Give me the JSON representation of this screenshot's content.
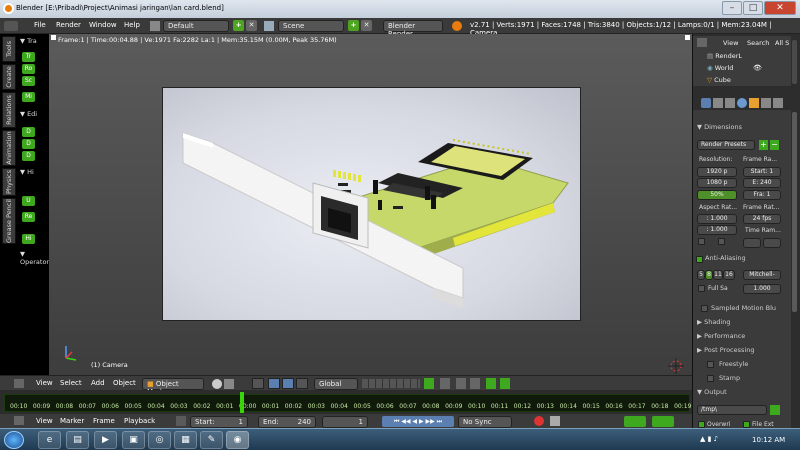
{
  "window": {
    "title": "Blender [E:\\Pribadi\\Project\\Animasi jaringan\\lan card.blend]"
  },
  "topbar": {
    "menus": [
      "File",
      "Render",
      "Window",
      "Help"
    ],
    "layout": "Default",
    "scene": "Scene",
    "engine": "Blender Render",
    "stats": "v2.71 | Verts:1971 | Faces:1748 | Tris:3840 | Objects:1/12 | Lamps:0/1 | Mem:23.04M | Camera"
  },
  "tool_tabs": [
    "Tools",
    "Create",
    "Relations",
    "Animation",
    "Physics",
    "Grease Pencil"
  ],
  "tool_panel": {
    "sections": [
      "Tra",
      "Edi",
      "Hi",
      "Operator"
    ],
    "buttons": [
      "Tr",
      "Ro",
      "Sc",
      "Mi",
      "D",
      "D",
      "D",
      "U",
      "Re",
      "Hi"
    ]
  },
  "viewport": {
    "info": "Frame:1 | Time:00:04.88 | Ve:1971 Fa:2282 La:1 | Mem:35.15M (0.00M, Peak 35.76M)",
    "camera_label": "(1) Camera"
  },
  "view_header": {
    "menus": [
      "View",
      "Select",
      "Add",
      "Object"
    ],
    "mode": "Object Mode",
    "orientation": "Global"
  },
  "timeline": {
    "ticks": [
      "00:10",
      "00:09",
      "00:08",
      "00:07",
      "00:06",
      "00:05",
      "00:04",
      "00:03",
      "00:02",
      "00:01",
      "00:00",
      "00:01",
      "00:02",
      "00:03",
      "00:04",
      "00:05",
      "00:06",
      "00:07",
      "00:08",
      "00:09",
      "00:10",
      "00:11",
      "00:12",
      "00:13",
      "00:14",
      "00:15",
      "00:16",
      "00:17",
      "00:18",
      "00:19"
    ],
    "menus": [
      "View",
      "Marker",
      "Frame",
      "Playback"
    ],
    "start_label": "Start:",
    "start": "1",
    "end_label": "End:",
    "end": "240",
    "current": "1",
    "sync": "No Sync"
  },
  "outliner": {
    "menus": [
      "View",
      "Search",
      "All S"
    ],
    "items": [
      "RenderL",
      "World",
      "Cube"
    ]
  },
  "properties": {
    "dimensions": "Dimensions",
    "render_presets": "Render Presets",
    "resolution_label": "Resolution:",
    "res_x": "1920 p",
    "res_y": "1080 p",
    "res_pct": "50%",
    "frame_range_label": "Frame Ra...",
    "frame_start": "Start: 1",
    "frame_end": "E: 240",
    "frame_step": "Fra: 1",
    "aspect_label": "Aspect Rat...",
    "aspect_x": ": 1.000",
    "aspect_y": ": 1.000",
    "framerate_label": "Frame Rat...",
    "fps": "24 fps",
    "time_remap": "Time Ram...",
    "anti_aliasing": "Anti-Aliasing",
    "aa_samples": [
      "5",
      "8",
      "11",
      "16"
    ],
    "aa_filter": "Mitchell-",
    "full_sample": "Full Sa",
    "aa_size": "1.000",
    "motion_blur": "Sampled Motion Blu",
    "shading": "Shading",
    "performance": "Performance",
    "post_processing": "Post Processing",
    "freestyle": "Freestyle",
    "stamp": "Stamp",
    "output": "Output",
    "output_path": "/tmp\\",
    "overwrite": "Overwri",
    "file_ext": "File Ext"
  },
  "taskbar": {
    "time": "10:12 AM"
  },
  "colors": {
    "accent_green": "#3ea81e",
    "timeline_green": "#3bd40a"
  }
}
